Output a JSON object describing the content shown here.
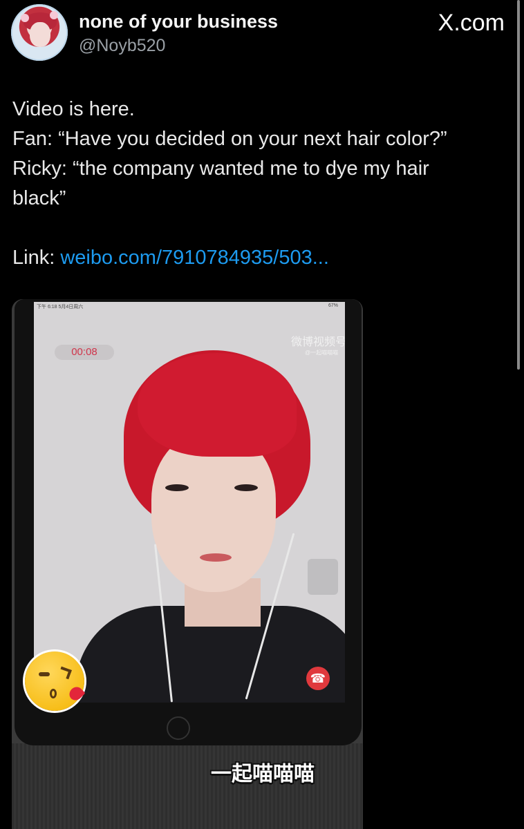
{
  "header": {
    "display_name": "none of your business",
    "handle": "@Noyb520",
    "brand": "X.com"
  },
  "tweet": {
    "lines": [
      "Video is here.",
      "Fan: “Have you decided on your next hair color?”",
      "Ricky: “the company wanted me to dye my hair",
      "black”"
    ],
    "link_label": "Link: ",
    "link_text": "weibo.com/7910784935/503..."
  },
  "media": {
    "call_timer": "00:08",
    "watermark_title": "微博视频号",
    "watermark_handle": "@一起喵喵喵",
    "caption": "一起喵喵喵",
    "statusbar_left": "下午 6:18  5月4日周六",
    "statusbar_right": "67%",
    "end_call_icon": "phone-hangup-icon",
    "emoji_icon": "kissing-wink-emoji"
  },
  "colors": {
    "background": "#000000",
    "link": "#1d9bf0",
    "end_call": "#e0393d",
    "hair": "#c8182b"
  }
}
